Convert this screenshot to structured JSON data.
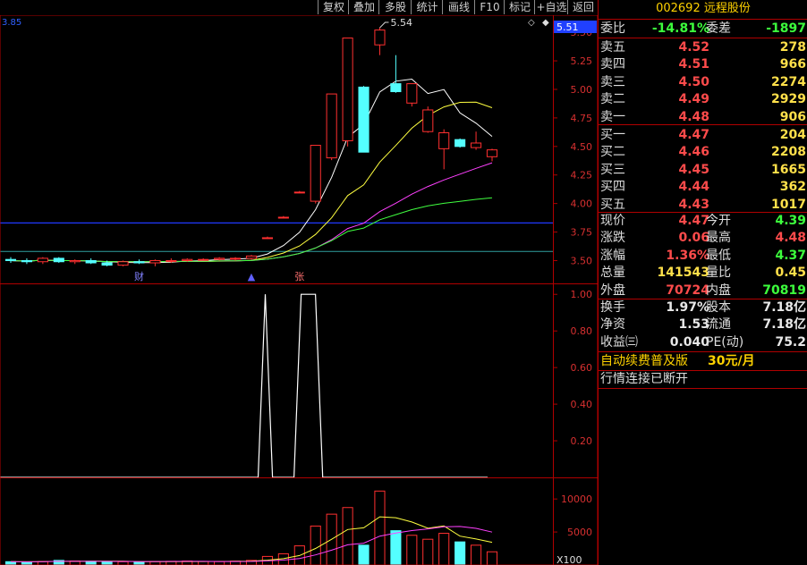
{
  "toolbar": {
    "buttons": [
      "复权",
      "叠加",
      "多股",
      "统计",
      "画线",
      "F10",
      "标记",
      "+自选",
      "返回"
    ]
  },
  "chart_data": [
    {
      "type": "candlestick",
      "price_label": "3.85",
      "current_price_tag": "5.51",
      "ylim": [
        3.3,
        5.65
      ],
      "y_ticks": [
        "5.50",
        "5.25",
        "5.00",
        "4.75",
        "4.50",
        "4.25",
        "4.00",
        "3.75",
        "3.50"
      ],
      "high_annotation": "5.54",
      "event_markers": [
        "财",
        "▲",
        "张"
      ],
      "candles": [
        {
          "o": 3.51,
          "h": 3.53,
          "l": 3.48,
          "c": 3.5
        },
        {
          "o": 3.5,
          "h": 3.52,
          "l": 3.47,
          "c": 3.49
        },
        {
          "o": 3.49,
          "h": 3.53,
          "l": 3.47,
          "c": 3.52
        },
        {
          "o": 3.52,
          "h": 3.53,
          "l": 3.48,
          "c": 3.49
        },
        {
          "o": 3.49,
          "h": 3.51,
          "l": 3.47,
          "c": 3.5
        },
        {
          "o": 3.5,
          "h": 3.52,
          "l": 3.47,
          "c": 3.48
        },
        {
          "o": 3.48,
          "h": 3.5,
          "l": 3.45,
          "c": 3.46
        },
        {
          "o": 3.46,
          "h": 3.5,
          "l": 3.45,
          "c": 3.49
        },
        {
          "o": 3.49,
          "h": 3.51,
          "l": 3.47,
          "c": 3.48
        },
        {
          "o": 3.48,
          "h": 3.51,
          "l": 3.45,
          "c": 3.5
        },
        {
          "o": 3.5,
          "h": 3.52,
          "l": 3.48,
          "c": 3.5
        },
        {
          "o": 3.5,
          "h": 3.52,
          "l": 3.49,
          "c": 3.51
        },
        {
          "o": 3.51,
          "h": 3.52,
          "l": 3.5,
          "c": 3.51
        },
        {
          "o": 3.51,
          "h": 3.53,
          "l": 3.5,
          "c": 3.52
        },
        {
          "o": 3.52,
          "h": 3.53,
          "l": 3.5,
          "c": 3.52
        },
        {
          "o": 3.52,
          "h": 3.55,
          "l": 3.51,
          "c": 3.54
        },
        {
          "o": 3.7,
          "h": 3.71,
          "l": 3.69,
          "c": 3.7
        },
        {
          "o": 3.88,
          "h": 3.89,
          "l": 3.87,
          "c": 3.88
        },
        {
          "o": 4.1,
          "h": 4.11,
          "l": 4.09,
          "c": 4.1
        },
        {
          "o": 4.02,
          "h": 4.51,
          "l": 4.0,
          "c": 4.51
        },
        {
          "o": 4.4,
          "h": 4.96,
          "l": 4.38,
          "c": 4.96
        },
        {
          "o": 4.55,
          "h": 5.45,
          "l": 4.5,
          "c": 5.45
        },
        {
          "o": 5.02,
          "h": 5.03,
          "l": 4.45,
          "c": 4.45
        },
        {
          "o": 5.39,
          "h": 5.54,
          "l": 5.3,
          "c": 5.52
        },
        {
          "o": 5.05,
          "h": 5.3,
          "l": 4.97,
          "c": 4.98
        },
        {
          "o": 4.88,
          "h": 5.05,
          "l": 4.85,
          "c": 5.05
        },
        {
          "o": 4.63,
          "h": 4.85,
          "l": 4.62,
          "c": 4.82
        },
        {
          "o": 4.48,
          "h": 4.65,
          "l": 4.3,
          "c": 4.62
        },
        {
          "o": 4.56,
          "h": 4.57,
          "l": 4.49,
          "c": 4.5
        },
        {
          "o": 4.49,
          "h": 4.63,
          "l": 4.47,
          "c": 4.53
        },
        {
          "o": 4.41,
          "h": 4.48,
          "l": 4.37,
          "c": 4.47
        }
      ]
    },
    {
      "type": "line",
      "ylim": [
        0,
        1.05
      ],
      "y_ticks": [
        "1.00",
        "0.80",
        "0.60",
        "0.40",
        "0.20"
      ],
      "values": [
        0,
        0,
        0,
        0,
        0,
        0,
        0,
        0,
        0,
        0,
        0,
        0,
        0,
        0,
        0,
        0,
        0,
        0,
        0,
        0,
        0,
        0,
        0,
        0,
        0,
        0,
        0,
        0,
        0,
        0,
        0,
        0,
        0,
        0,
        0,
        0,
        0,
        1,
        0,
        0,
        0,
        0,
        1,
        1,
        1,
        0,
        0,
        0,
        0,
        0,
        0,
        0,
        0,
        0,
        0,
        0,
        0,
        0,
        0,
        0,
        0,
        0,
        0,
        0,
        0,
        0,
        0,
        0,
        0
      ]
    },
    {
      "type": "bar",
      "ylim": [
        0,
        13000
      ],
      "y_ticks": [
        "10000",
        "5000"
      ],
      "unit_label": "X100",
      "volumes": [
        500,
        480,
        520,
        700,
        600,
        560,
        480,
        500,
        450,
        520,
        560,
        600,
        540,
        520,
        580,
        700,
        1300,
        1700,
        2900,
        5900,
        7700,
        8700,
        3000,
        11200,
        5200,
        4500,
        3900,
        4800,
        3500,
        3000,
        2000
      ]
    }
  ],
  "quote_panel": {
    "code": "002692",
    "name": "远程股份",
    "weibi": {
      "label": "委比",
      "value": "-14.81%",
      "label2": "委差",
      "value2": "-1897"
    },
    "sell": [
      {
        "label": "卖五",
        "price": "4.52",
        "vol": "278"
      },
      {
        "label": "卖四",
        "price": "4.51",
        "vol": "966"
      },
      {
        "label": "卖三",
        "price": "4.50",
        "vol": "2274"
      },
      {
        "label": "卖二",
        "price": "4.49",
        "vol": "2929"
      },
      {
        "label": "卖一",
        "price": "4.48",
        "vol": "906"
      }
    ],
    "buy": [
      {
        "label": "买一",
        "price": "4.47",
        "vol": "204"
      },
      {
        "label": "买二",
        "price": "4.46",
        "vol": "2208"
      },
      {
        "label": "买三",
        "price": "4.45",
        "vol": "1665"
      },
      {
        "label": "买四",
        "price": "4.44",
        "vol": "362"
      },
      {
        "label": "买五",
        "price": "4.43",
        "vol": "1017"
      }
    ],
    "stats": [
      {
        "l1": "现价",
        "v1": "4.47",
        "l2": "今开",
        "v2": "4.39"
      },
      {
        "l1": "涨跌",
        "v1": "0.06",
        "l2": "最高",
        "v2": "4.48"
      },
      {
        "l1": "涨幅",
        "v1": "1.36%",
        "l2": "最低",
        "v2": "4.37"
      },
      {
        "l1": "总量",
        "v1": "141543",
        "l2": "量比",
        "v2": "0.45"
      },
      {
        "l1": "外盘",
        "v1": "70724",
        "l2": "内盘",
        "v2": "70819"
      }
    ],
    "finance": [
      {
        "l1": "换手",
        "v1": "1.97%",
        "l2": "股本",
        "v2": "7.18亿"
      },
      {
        "l1": "净资",
        "v1": "1.53",
        "l2": "流通",
        "v2": "7.18亿"
      },
      {
        "l1": "收益㈢",
        "v1": "0.040",
        "l2": "PE(动)",
        "v2": "75.2"
      }
    ],
    "promo": {
      "text": "自动续费普及版",
      "price": "30元/月"
    },
    "status": "行情连接已断开"
  }
}
